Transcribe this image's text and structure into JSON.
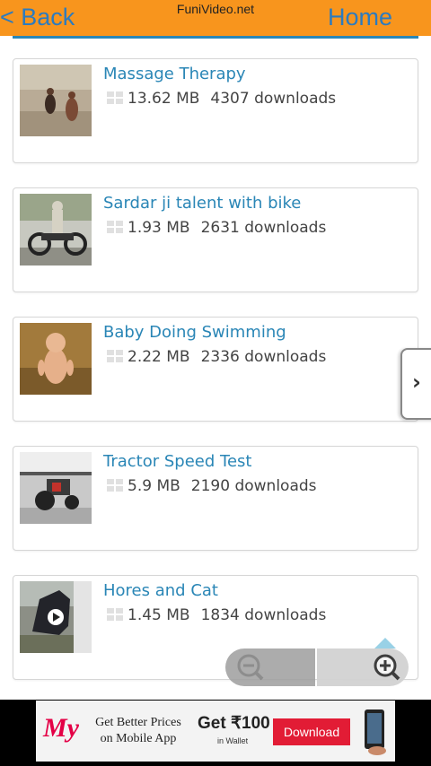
{
  "header": {
    "back_label": "< Back",
    "site_name": "FuniVideo.net",
    "home_label": "Home",
    "accent_color": "#f8951d",
    "link_color": "#2a86b6"
  },
  "videos": [
    {
      "title": "Massage Therapy",
      "size": "13.62 MB",
      "downloads": "4307 downloads",
      "thumb": "beach-scene-thumbnail"
    },
    {
      "title": "Sardar ji talent with bike",
      "size": "1.93 MB",
      "downloads": "2631 downloads",
      "thumb": "bike-rider-thumbnail"
    },
    {
      "title": "Baby Doing Swimming",
      "size": "2.22 MB",
      "downloads": "2336 downloads",
      "thumb": "baby-thumbnail"
    },
    {
      "title": "Tractor Speed Test",
      "size": "5.9 MB",
      "downloads": "2190 downloads",
      "thumb": "tractor-thumbnail"
    },
    {
      "title": "Hores and Cat",
      "size": "1.45 MB",
      "downloads": "1834 downloads",
      "thumb": "horse-thumbnail"
    }
  ],
  "side_tab": {
    "icon": "chevron-right-icon",
    "label": "›"
  },
  "zoom": {
    "out_icon": "zoom-out-icon",
    "in_icon": "zoom-in-icon"
  },
  "ad": {
    "logo": "My",
    "text_line1": "Get Better Prices",
    "text_line2": "on Mobile App",
    "offer": "Get ₹100",
    "offer_sub": "in Wallet",
    "button": "Download"
  }
}
